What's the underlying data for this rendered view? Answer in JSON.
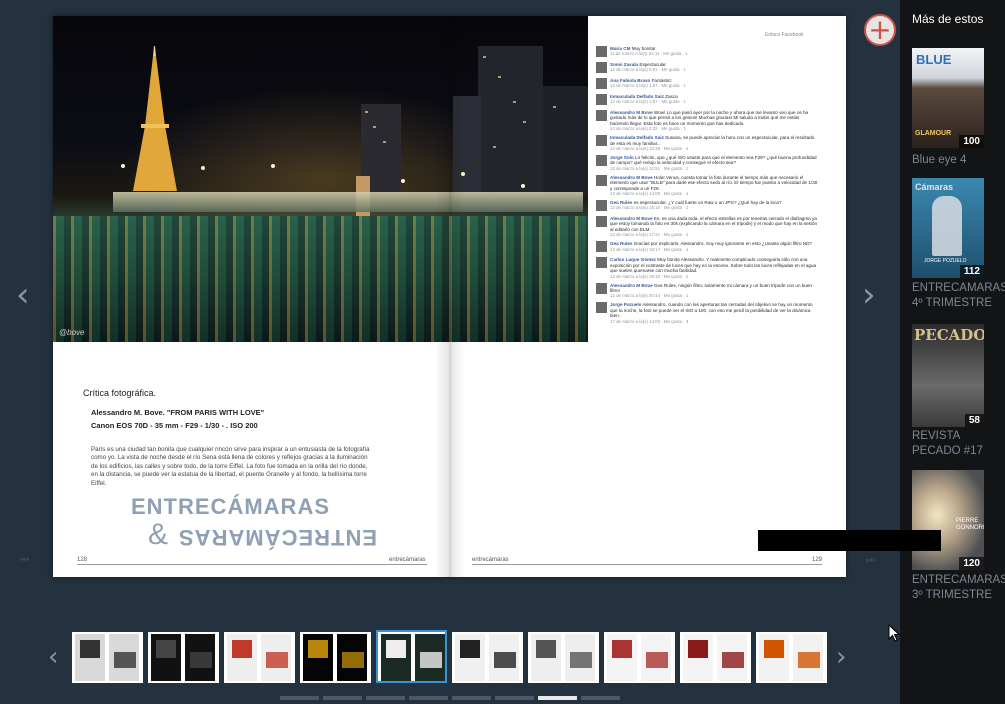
{
  "viewer": {
    "prev_arrow": "‹",
    "next_arrow": "›",
    "first_arrow": "⏮",
    "last_arrow": "⏭"
  },
  "left_page": {
    "watermark": "@bove",
    "section_title": "Crítica fotográfica.",
    "photo_title": "Alessandro M. Bove. \"FROM PARIS WITH LOVE\"",
    "photo_specs": "Canon EOS 70D - 35 mm - F29 - 1/30 - . ISO 200",
    "body": "París es una ciudad tan bonita que cualquier rincón sirve para inspirar a un entusiasta de la fotografía como yo. La vista de noche desde el río Sena está llena de colores y reflejos gracias a la iluminación de los edificios, las calles y sobre todo, de la torre Eiffel. La foto fue tomada en la orilla del río donde, en la distancia, se puede ver la estatua de la libertad, el puente Granelle y al fondo, la bellísima torre Eiffel.",
    "logo_line1": "ENTRECÁMARAS",
    "logo_amp": "&",
    "logo_line2": "ENTRECÁMARAS",
    "page_number": "128",
    "footer_brand": "entrecámaras"
  },
  "right_page": {
    "fb_header": "Enlace Facebook",
    "page_number": "129",
    "footer_brand": "entrecámaras",
    "comments": [
      {
        "name": "Maria CM",
        "text": "Muy bonita!",
        "meta": "11 de marzo a la(s) 22:11 · Me gusta · 1"
      },
      {
        "name": "Sonsi Zavala",
        "text": "Espectacular",
        "meta": "12 de marzo a la(s) 0:01 · Me gusta · 1"
      },
      {
        "name": "Ana Fabiola Bravo",
        "text": "Fantástic!",
        "meta": "12 de marzo a la(s) 1:57 · Me gusta · 1"
      },
      {
        "name": "Inmaculada Delfado Saiz",
        "text": "Zasca",
        "meta": "12 de marzo a la(s) 1:57 · Me gusta · 1"
      },
      {
        "name": "Alessandro M Bove",
        "text": "Wow! Lo que pasó ayer por la noche y ahora que me levanto veo que os ha gustado más de lo que pensé a los genios! Muchas gracias! Mi saludo a todos qué me estáis haciendo llegar. Esta foto es hace un momento que has dedicado.",
        "meta": "12 de marzo a la(s) 3:22 · Me gusta · 1"
      },
      {
        "name": "Inmaculada Delfado Saiz",
        "text": "Susana, se puede apreciar la hora con un espectacular, para el resultado de esta es muy familiar...",
        "meta": "12 de marzo a la(s) 10:38 · Me gusta · 1"
      },
      {
        "name": "Jorge Solo",
        "text": "Lo felicito, que ¿qué ISO usaste para que el elemento sea F29? ¿qué buena profundidad de campo? qué redujo la velocidad y conseguir el efecto sea?",
        "meta": "12 de marzo a la(s) 12:51 · Me gusta · 1"
      },
      {
        "name": "Alessandro M Bove",
        "text": "Hola! Venus, cuesta tomar la foto durante el tiempo más que necesario el elemento que usar \"BULB\" para darle ese efecto sedo al río. El tiempo fue puesto a velocidad de 1/30 y corresponde a un F29.",
        "meta": "12 de marzo a la(s) 14:09 · Me gusta · 1"
      },
      {
        "name": "Gea Rules",
        "text": "es espectacular. ¿Y cuál fuerte un Raw o un JPG? ¿Qué hay de la loca?",
        "meta": "12 de marzo a la(s) 16:10 · Me gusta · 1"
      },
      {
        "name": "Alessandro M Bove",
        "text": "Es, es una dada toda, el efecto estrellas es por tenerlas cerrado el diafragma ya que estoy tomando la foto en 30s (explicando la cámara en el trípode) y el modo que hay en la sesión al editarlo con ELM.",
        "meta": "12 de marzo a la(s) 17:21 · Me gusta · 1"
      },
      {
        "name": "Gea Rules",
        "text": "Gracias por explicarlo, Alessandro. Soy muy ignorante en esto ¿Usaste algún filtro ND?",
        "meta": "12 de marzo a la(s) 18:17 · Me gusta · 1"
      },
      {
        "name": "Carlos Luque Gómez",
        "text": "Muy bonita Alessandro. Y realmente complicado conseguirla sólo con una exposición por el contraste de luces que hay en la escena. Sobre todo las luces reflejadas en el agua que suelen quemarse con mucha facilidad.",
        "meta": "12 de marzo a la(s) 19:32 · Me gusta · 2"
      },
      {
        "name": "Alessandro M Bove",
        "text": "Gea Rules, ningún filtro, solamente mi cámara y un buen trípode con un buen filtro!",
        "meta": "12 de marzo a la(s) 20:44 · Me gusta · 1"
      },
      {
        "name": "Jorge Pozuelo",
        "text": "Alessandro, cuando con las aperturas tan cerradas del objetivo se hay un momento que la noche, la foto se puede ver el ISO a 100, con eso me perdí la posibilidad de ver la dinámica bien.",
        "meta": "17 de marzo a la(s) 14:03 · Me gusta · 3"
      }
    ]
  },
  "thumbnails": [
    {
      "label": "thumb-1"
    },
    {
      "label": "thumb-2"
    },
    {
      "label": "thumb-3"
    },
    {
      "label": "thumb-4"
    },
    {
      "label": "thumb-5"
    },
    {
      "label": "thumb-6"
    },
    {
      "label": "thumb-7"
    },
    {
      "label": "thumb-8"
    },
    {
      "label": "thumb-9"
    },
    {
      "label": "thumb-10"
    }
  ],
  "pager": {
    "active_index": 6,
    "count": 8
  },
  "sidebar": {
    "title": "Más de estos",
    "add_symbol": "+",
    "items": [
      {
        "title": "Blue eye 4",
        "count": "100",
        "cover_text": "BLUE",
        "cover_sub": "GLAMOUR",
        "cover_bg": "#f2f4f7"
      },
      {
        "title": "ENTRECAMARAS 4º TRIMESTRE",
        "count": "112",
        "cover_text": "Cámaras",
        "cover_sub": "JORGE POZUELO",
        "cover_bg": "#2d6a8a"
      },
      {
        "title": "REVISTA PECADO #17",
        "count": "58",
        "cover_text": "PECADO",
        "cover_sub": "",
        "cover_bg": "#3a3a3a"
      },
      {
        "title": "ENTRECAMARAS 3º TRIMESTRE",
        "count": "120",
        "cover_text": "PIERRE GONNORD",
        "cover_sub": "",
        "cover_bg": "#5a5e63"
      }
    ]
  },
  "colors": {
    "accent": "#3a93d3",
    "add_ring": "#c9524a",
    "bg": "#243240",
    "sidebar_bg": "#131416"
  }
}
